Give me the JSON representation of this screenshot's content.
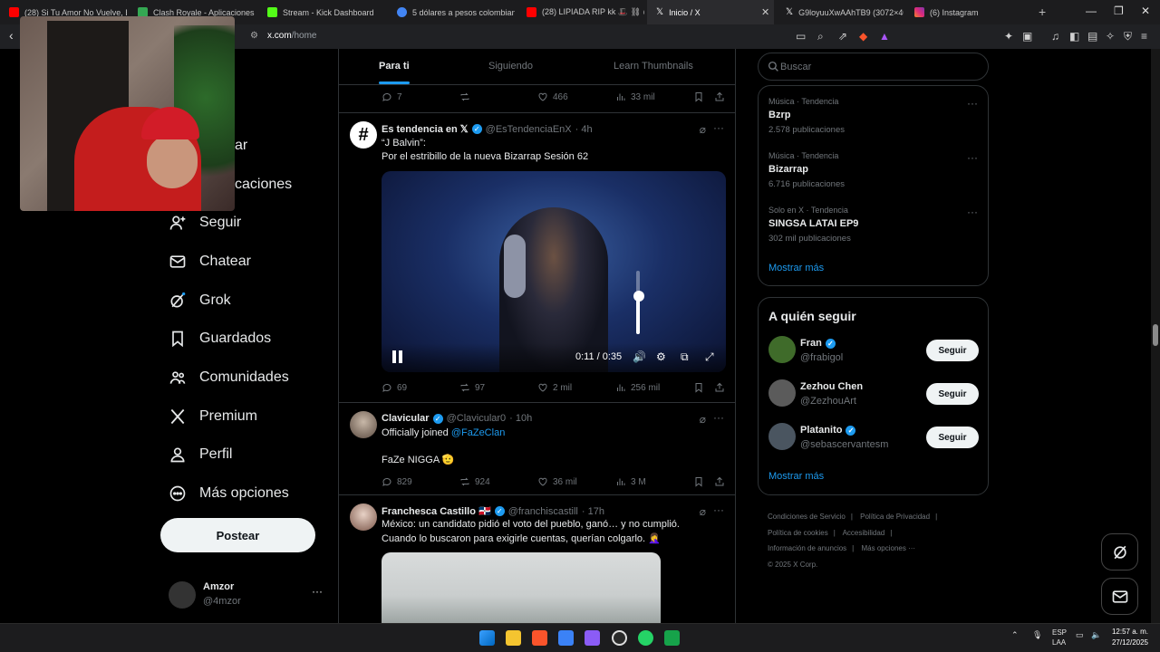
{
  "browser": {
    "tabs": [
      {
        "label": "(28) Si Tu Amor No Vuelve, Bin",
        "color": "#ff0000"
      },
      {
        "label": "Clash Royale - Aplicaciones en",
        "color": "#34a853"
      },
      {
        "label": "Stream - Kick Dashboard",
        "color": "#53fc18"
      },
      {
        "label": "5 dólares a pesos colombianos",
        "color": "#4285f4"
      },
      {
        "label": "(28) LIPIADA RIP kk 🎩 ⛓ @E",
        "color": "#ff0000"
      },
      {
        "label": "Inicio / X",
        "color": "#ffffff"
      },
      {
        "label": "G9loyuuXwAAhTB9 (3072×4096)",
        "color": "#ffffff"
      },
      {
        "label": "(6) Instagram",
        "color": "#e1306c"
      }
    ],
    "address": {
      "host": "x.com",
      "path": "/home"
    }
  },
  "nav": {
    "peek1": "ar",
    "peek2": "caciones",
    "items": [
      {
        "label": "Seguir",
        "icon": "person-plus-icon"
      },
      {
        "label": "Chatear",
        "icon": "mail-icon"
      },
      {
        "label": "Grok",
        "icon": "grok-icon"
      },
      {
        "label": "Guardados",
        "icon": "bookmark-icon"
      },
      {
        "label": "Comunidades",
        "icon": "people-icon"
      },
      {
        "label": "Premium",
        "icon": "x-logo-icon"
      },
      {
        "label": "Perfil",
        "icon": "person-icon"
      },
      {
        "label": "Más opciones",
        "icon": "more-circle-icon"
      }
    ],
    "post_label": "Postear",
    "account": {
      "name": "Amzor",
      "handle": "@4mzor"
    }
  },
  "feed": {
    "tabs": [
      {
        "label": "Para ti",
        "active": true
      },
      {
        "label": "Siguiendo",
        "active": false
      },
      {
        "label": "Learn Thumbnails",
        "active": false
      }
    ],
    "top_actions": {
      "replies": "7",
      "reposts": "",
      "likes": "466",
      "views": "33 mil"
    },
    "tweets": [
      {
        "name": "Es tendencia en 𝕏",
        "handle": "@EsTendenciaEnX",
        "time": "· 4h",
        "line1": "“J Balvin”:",
        "line2": "Por el estribillo de la nueva Bizarrap Sesión 62",
        "video": {
          "time": "0:11 / 0:35",
          "volume": 0.6
        },
        "actions": {
          "replies": "69",
          "reposts": "97",
          "likes": "2 mil",
          "views": "256 mil"
        }
      },
      {
        "name": "Clavicular",
        "handle": "@Clavicular0",
        "time": "· 10h",
        "line1_prefix": "Officially joined ",
        "line1_link": "@FaZeClan",
        "line2": "FaZe NIGGA 🫡",
        "actions": {
          "replies": "829",
          "reposts": "924",
          "likes": "36 mil",
          "views": "3 M"
        }
      },
      {
        "name": "Franchesca Castillo 🇩🇴",
        "handle": "@franchiscastill",
        "time": "· 17h",
        "line1": "México: un candidato pidió el voto del pueblo, ganó… y no cumplió.",
        "line2": "Cuando lo buscaron para exigirle cuentas, querían colgarlo. 🤦‍♀️"
      }
    ]
  },
  "sidebar": {
    "search_placeholder": "Buscar",
    "trends": [
      {
        "context": "Música · Tendencia",
        "title": "Bzrp",
        "count": "2.578 publicaciones"
      },
      {
        "context": "Música · Tendencia",
        "title": "Bizarrap",
        "count": "6.716 publicaciones"
      },
      {
        "context": "Solo en X · Tendencia",
        "title": "SINGSA LATAI EP9",
        "count": "302 mil publicaciones"
      }
    ],
    "show_more": "Mostrar más",
    "who_to_follow": {
      "title": "A quién seguir",
      "follow_label": "Seguir",
      "users": [
        {
          "name": "Fran",
          "handle": "@frabigol",
          "avatar": "#3f6b2a"
        },
        {
          "name": "Zezhou Chen",
          "handle": "@ZezhouArt",
          "avatar": "#5b5b5b"
        },
        {
          "name": "Platanito",
          "handle": "@sebascervantesm",
          "avatar": "#4a5560"
        }
      ],
      "show_more": "Mostrar más"
    },
    "footer": {
      "links": [
        "Condiciones de Servicio",
        "|",
        "Política de Privacidad",
        "|",
        "Política de cookies",
        "|",
        "Accesibilidad",
        "|",
        "Información de anuncios",
        "|",
        "Más opciones ···"
      ],
      "copyright": "© 2025 X Corp."
    }
  },
  "taskbar": {
    "lang1": "ESP",
    "lang2": "LAA",
    "time": "12:57 a. m.",
    "date": "27/12/2025"
  }
}
